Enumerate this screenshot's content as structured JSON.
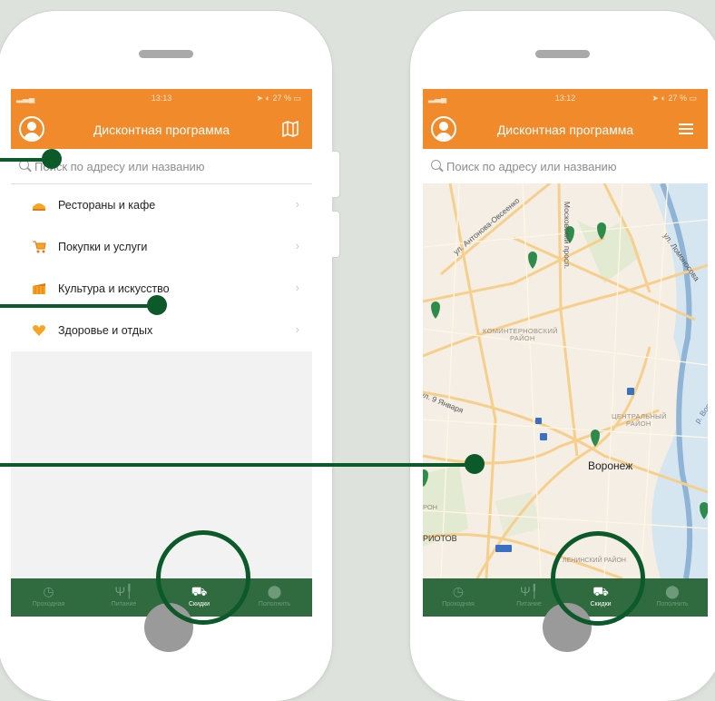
{
  "colors": {
    "header": "#f08a2b",
    "tabbar": "#2f6b3e",
    "annotation": "#0c5a2a",
    "pin": "#2e8b4a"
  },
  "left_phone": {
    "status": {
      "time": "13:13",
      "battery": "27 %"
    },
    "header": {
      "title": "Дисконтная программа",
      "right_icon": "map-icon"
    },
    "search": {
      "placeholder": "Поиск по адресу или названию"
    },
    "categories": [
      {
        "label": "Рестораны и кафе",
        "icon": "food-icon",
        "chevron": "›"
      },
      {
        "label": "Покупки и услуги",
        "icon": "cart-icon",
        "chevron": "›"
      },
      {
        "label": "Культура и искусство",
        "icon": "theater-icon",
        "chevron": "›"
      },
      {
        "label": "Здоровье и отдых",
        "icon": "heart-icon",
        "chevron": "›"
      }
    ],
    "tabs": [
      {
        "label": "Проходная",
        "icon": "clock-icon"
      },
      {
        "label": "Питание",
        "icon": "fork-knife-icon"
      },
      {
        "label": "Скидки",
        "icon": "cart-icon",
        "active": true
      },
      {
        "label": "Пополнить",
        "icon": "pin-icon"
      }
    ]
  },
  "right_phone": {
    "status": {
      "time": "13:12",
      "battery": "27 %"
    },
    "header": {
      "title": "Дисконтная программа",
      "right_icon": "list-icon"
    },
    "search": {
      "placeholder": "Поиск по адресу или названию"
    },
    "map_labels": {
      "street1": "ул. Антонова-Овсеенко",
      "street2": "Московский просп.",
      "street3": "ул. Ломоносова",
      "district1": "КОМИНТЕРНОВСКИЙ",
      "district1b": "РАЙОН",
      "street4": "ул. 9 Января",
      "district2": "ЦЕНТРАЛЬНЫЙ",
      "district2b": "РАЙОН",
      "city": "Воронеж",
      "river": "р. Воронеж",
      "partial1": "РИОТОВ",
      "partial2": "РОН",
      "district3": "ЛЕНИНСКИЙ РАЙОН"
    },
    "tabs": [
      {
        "label": "Проходная",
        "icon": "clock-icon"
      },
      {
        "label": "Питание",
        "icon": "fork-knife-icon"
      },
      {
        "label": "Скидки",
        "icon": "cart-icon",
        "active": true
      },
      {
        "label": "Пополнить",
        "icon": "pin-icon"
      }
    ]
  }
}
